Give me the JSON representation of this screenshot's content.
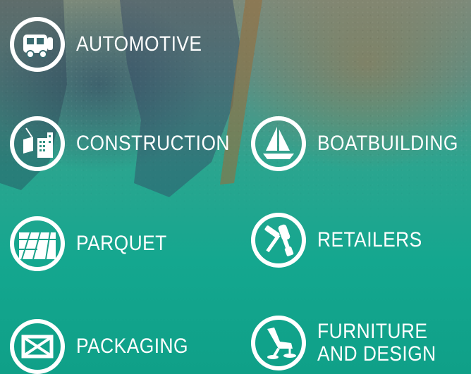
{
  "categories": [
    {
      "label": "AUTOMOTIVE",
      "icon": "motorhome-icon"
    },
    {
      "label": "CONSTRUCTION",
      "icon": "buildings-crane-icon"
    },
    {
      "label": "BOATBUILDING",
      "icon": "sailboat-icon"
    },
    {
      "label": "PARQUET",
      "icon": "wood-floor-icon"
    },
    {
      "label": "RETAILERS",
      "icon": "tools-icon"
    },
    {
      "label": "PACKAGING",
      "icon": "box-icon"
    },
    {
      "label": "FURNITURE",
      "label2": "AND DESIGN",
      "icon": "chair-icon"
    }
  ],
  "colors": {
    "accent": "#13a58e",
    "text": "#ffffff"
  }
}
